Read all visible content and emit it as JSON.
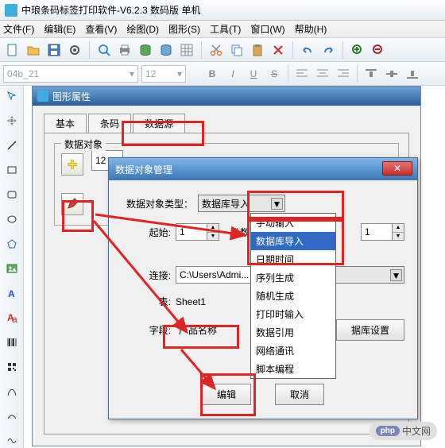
{
  "app_title": "中琅条码标签打印软件-V6.2.3 数码版 单机",
  "menu": {
    "file": "文件(F)",
    "edit": "编辑(E)",
    "view": "查看(V)",
    "draw": "绘图(D)",
    "shape": "图形(S)",
    "tool": "工具(T)",
    "window": "窗口(W)",
    "help": "帮助(H)"
  },
  "font_combo": "04b_21",
  "size_combo": "12",
  "propwin_title": "图形属性",
  "tabs": {
    "basic": "基本",
    "barcode": "条码",
    "datasrc": "数据源"
  },
  "group_label": "数据对象",
  "group_value": "12",
  "dlg_title": "数据对象管理",
  "dlg": {
    "type_label": "数据对象类型：",
    "type_value": "数据库导入",
    "start_label": "起始:",
    "start_value": "1",
    "count_label": "份数",
    "count_value": "1",
    "connect_label": "连接:",
    "connect_value": "C:\\Users\\Admi...",
    "table_label": "表:",
    "table_value": "Sheet1",
    "field_label": "字段:",
    "field_value": "产品名称",
    "dbset_btn": "据库设置",
    "edit_btn": "编辑",
    "cancel_btn": "取消"
  },
  "dropdown_items": [
    "手动输入",
    "数据库导入",
    "日期时间",
    "序列生成",
    "随机生成",
    "打印时输入",
    "数据引用",
    "网络通讯",
    "脚本编程"
  ],
  "watermark": "中文网"
}
